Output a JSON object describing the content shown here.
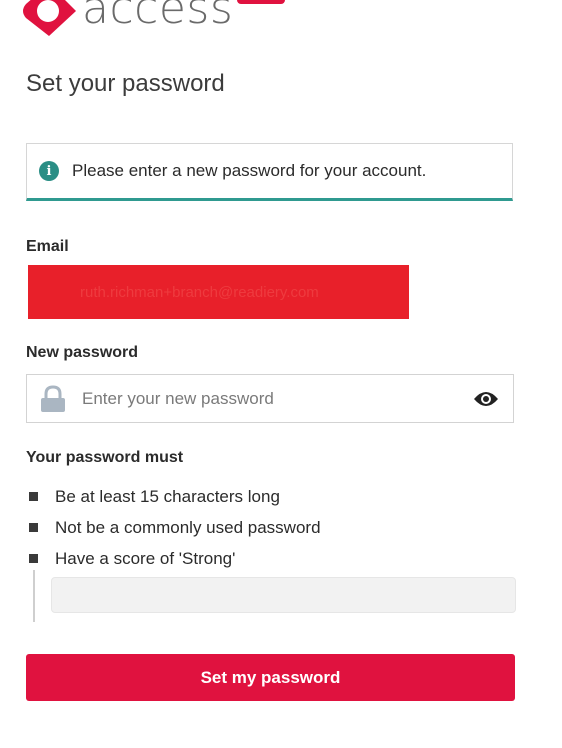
{
  "brand": {
    "logo_text": "access",
    "primary_color": "#e0123f",
    "accent_color": "#2f9a90"
  },
  "page": {
    "title": "Set your password"
  },
  "notice": {
    "icon": "info-icon",
    "icon_glyph": "i",
    "text": "Please enter a new password for your account."
  },
  "email": {
    "label": "Email",
    "value": "ruth.richman+branch@readiery.com"
  },
  "new_password": {
    "label": "New password",
    "placeholder": "Enter your new password",
    "value": "",
    "leading_icon": "lock-icon",
    "trailing_icon": "eye-icon"
  },
  "requirements": {
    "heading": "Your password must",
    "items": [
      {
        "text": "Be at least 15 characters long"
      },
      {
        "text": "Not be a commonly used password"
      },
      {
        "text": "Have a score of 'Strong'"
      }
    ]
  },
  "strength_meter": {
    "level": 0
  },
  "submit": {
    "label": "Set my password"
  }
}
